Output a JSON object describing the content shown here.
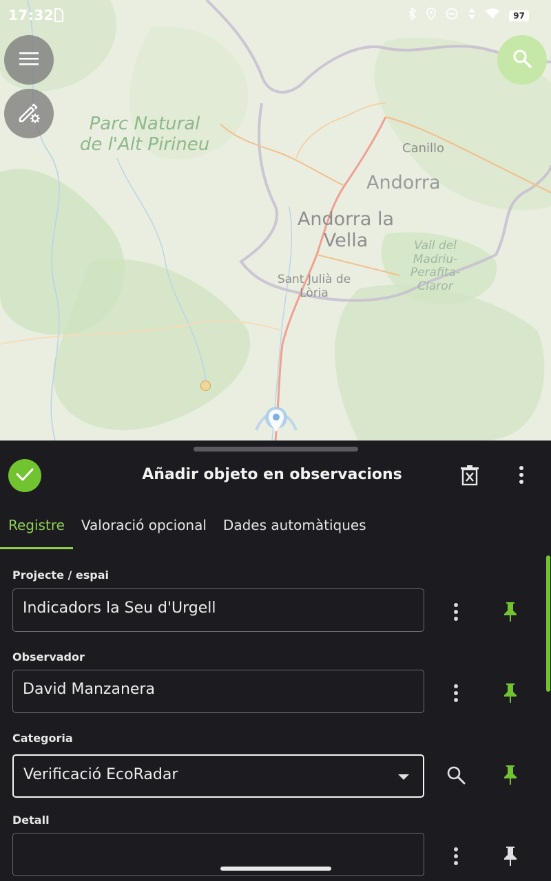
{
  "status_bar": {
    "time": "17:32",
    "battery": "97",
    "icons": [
      "sim-icon",
      "bluetooth-icon",
      "location-icon",
      "dnd-icon",
      "data-icon",
      "wifi-icon",
      "battery-icon"
    ]
  },
  "map": {
    "labels": {
      "park": "Parc Natural de l'Alt Pirineu",
      "andorra": "Andorra",
      "andorra_la_vella": "Andorra la Vella",
      "canillo": "Canillo",
      "sant_julia": "Sant Julià de Lòria",
      "vall": "Vall del Madriu-Perafita-Claror"
    },
    "buttons": [
      "menu-icon",
      "edit-settings-icon",
      "search-icon"
    ]
  },
  "sheet": {
    "title": "Añadir objeto en observacions",
    "tabs": [
      {
        "label": "Registre",
        "active": true
      },
      {
        "label": "Valoració opcional",
        "active": false
      },
      {
        "label": "Dades automàtiques",
        "active": false
      }
    ],
    "fields": [
      {
        "label": "Projecte / espai",
        "value": "Indicadors la Seu d'Urgell",
        "action_icon": "more-vert-icon",
        "pinned": true
      },
      {
        "label": "Observador",
        "value": "David Manzanera",
        "action_icon": "more-vert-icon",
        "pinned": true
      },
      {
        "label": "Categoria",
        "value": "Verificació EcoRadar",
        "action_icon": "search-icon",
        "pinned": true,
        "dropdown": true
      },
      {
        "label": "Detall",
        "value": "",
        "action_icon": "more-vert-icon",
        "pinned": false
      }
    ]
  },
  "colors": {
    "accent": "#71c42f",
    "accent_light": "#8fd14f",
    "sheet_bg": "#1c1b20",
    "search_fab": "#c5e8a8"
  }
}
